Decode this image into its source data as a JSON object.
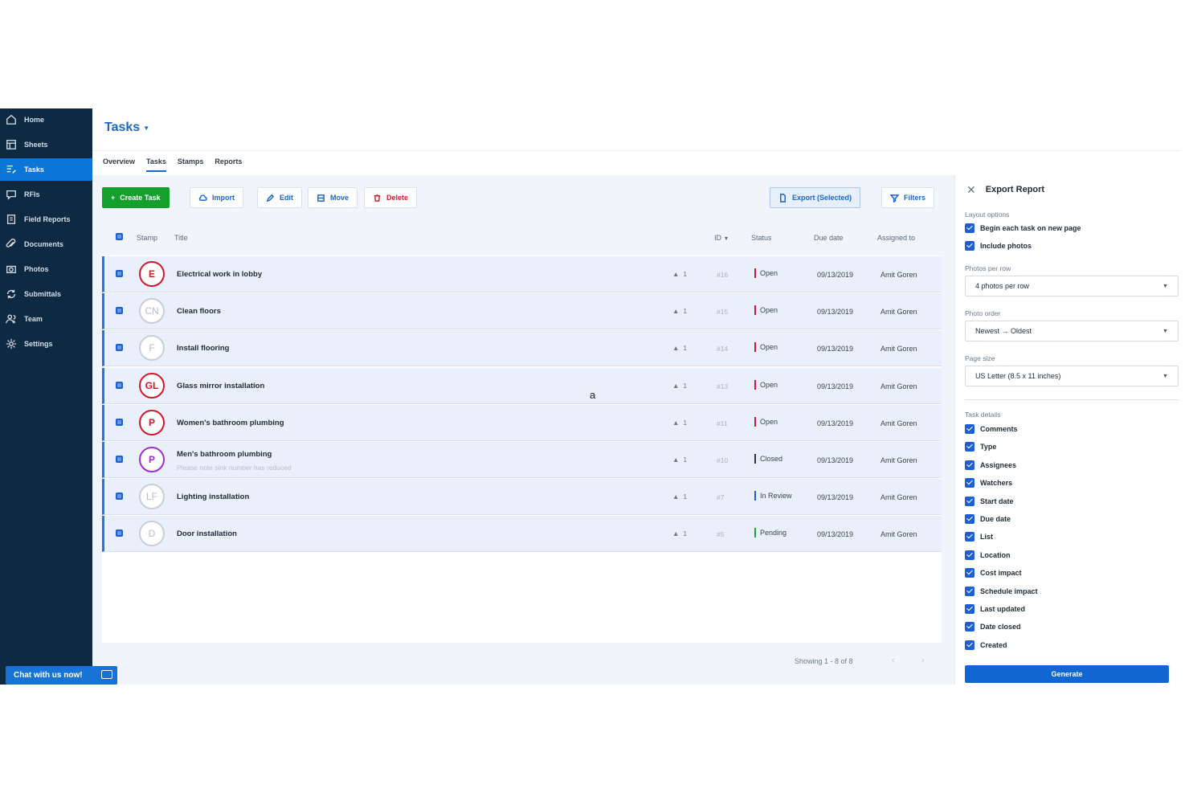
{
  "sidebar": {
    "items": [
      {
        "label": "Home",
        "icon": "home-icon"
      },
      {
        "label": "Sheets",
        "icon": "sheets-icon"
      },
      {
        "label": "Tasks",
        "icon": "tasks-icon",
        "active": true
      },
      {
        "label": "RFIs",
        "icon": "rfi-icon"
      },
      {
        "label": "Field Reports",
        "icon": "clipboard-icon"
      },
      {
        "label": "Documents",
        "icon": "paperclip-icon"
      },
      {
        "label": "Photos",
        "icon": "camera-icon"
      },
      {
        "label": "Submittals",
        "icon": "cycle-icon"
      },
      {
        "label": "Team",
        "icon": "team-icon"
      },
      {
        "label": "Settings",
        "icon": "gear-icon"
      }
    ],
    "chat_label": "Chat with us now!"
  },
  "header": {
    "title": "Tasks",
    "tabs": [
      "Overview",
      "Tasks",
      "Stamps",
      "Reports"
    ],
    "active_tab": "Tasks"
  },
  "toolbar": {
    "create": "Create Task",
    "import": "Import",
    "edit": "Edit",
    "move": "Move",
    "delete": "Delete",
    "export": "Export (Selected)",
    "filters": "Filters"
  },
  "table": {
    "columns": {
      "stamp": "Stamp",
      "title": "Title",
      "id": "ID",
      "status": "Status",
      "due": "Due date",
      "assigned": "Assigned to"
    },
    "rows": [
      {
        "stamp": "E",
        "stamp_style": "red",
        "title": "Electrical work in lobby",
        "subtitle": "",
        "count": "1",
        "id": "#16",
        "status": "Open",
        "status_color": "#d0182a",
        "due": "09/13/2019",
        "assigned": "Amit Goren"
      },
      {
        "stamp": "CN",
        "stamp_style": "gray",
        "title": "Clean floors",
        "subtitle": "",
        "count": "1",
        "id": "#15",
        "status": "Open",
        "status_color": "#d0182a",
        "due": "09/13/2019",
        "assigned": "Amit Goren"
      },
      {
        "stamp": "F",
        "stamp_style": "gray",
        "title": "Install flooring",
        "subtitle": "",
        "count": "1",
        "id": "#14",
        "status": "Open",
        "status_color": "#d0182a",
        "due": "09/13/2019",
        "assigned": "Amit Goren"
      },
      {
        "stamp": "GL",
        "stamp_style": "red",
        "title": "Glass mirror installation",
        "subtitle": "",
        "count": "1",
        "id": "#13",
        "status": "Open",
        "status_color": "#d0182a",
        "due": "09/13/2019",
        "assigned": "Amit Goren"
      },
      {
        "stamp": "P",
        "stamp_style": "red",
        "title": "Women's bathroom plumbing",
        "subtitle": "",
        "count": "1",
        "id": "#11",
        "status": "Open",
        "status_color": "#d0182a",
        "due": "09/13/2019",
        "assigned": "Amit Goren"
      },
      {
        "stamp": "P",
        "stamp_style": "purple",
        "title": "Men's bathroom plumbing",
        "subtitle": "Please note sink number has reduced",
        "count": "1",
        "id": "#10",
        "status": "Closed",
        "status_color": "#2b3442",
        "due": "09/13/2019",
        "assigned": "Amit Goren"
      },
      {
        "stamp": "LF",
        "stamp_style": "gray",
        "title": "Lighting installation",
        "subtitle": "",
        "count": "1",
        "id": "#7",
        "status": "In Review",
        "status_color": "#1c5fd3",
        "due": "09/13/2019",
        "assigned": "Amit Goren"
      },
      {
        "stamp": "D",
        "stamp_style": "gray",
        "title": "Door installation",
        "subtitle": "",
        "count": "1",
        "id": "#5",
        "status": "Pending",
        "status_color": "#22a03a",
        "due": "09/13/2019",
        "assigned": "Amit Goren"
      }
    ],
    "showing": "Showing 1 - 8 of 8"
  },
  "cursor_text": "a",
  "export_panel": {
    "title": "Export Report",
    "layout_label": "Layout options",
    "layout_options": [
      "Begin each task on new page",
      "Include photos"
    ],
    "photos_per_row_label": "Photos per row",
    "photos_per_row": "4 photos per row",
    "photo_order_label": "Photo order",
    "photo_order": "Newest → Oldest",
    "page_size_label": "Page size",
    "page_size": "US Letter (8.5 x 11 inches)",
    "task_details_label": "Task details",
    "task_details": [
      "Comments",
      "Type",
      "Assignees",
      "Watchers",
      "Start date",
      "Due date",
      "List",
      "Location",
      "Cost impact",
      "Schedule impact",
      "Last updated",
      "Date closed",
      "Created"
    ],
    "generate": "Generate"
  }
}
